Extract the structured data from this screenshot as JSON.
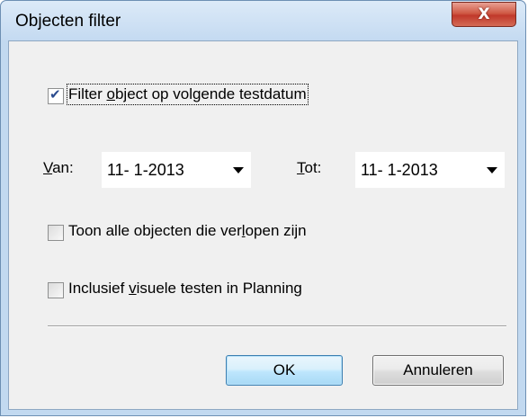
{
  "window": {
    "title": "Objecten filter",
    "close_glyph": "X"
  },
  "filter_checkbox": {
    "checked": true,
    "label_pre": "Filter ",
    "label_accel": "o",
    "label_post": "bject op volgende testdatum"
  },
  "van": {
    "label_accel": "V",
    "label_post": "an:",
    "value": "11- 1-2013"
  },
  "tot": {
    "label_accel": "T",
    "label_post": "ot:",
    "value": "11- 1-2013"
  },
  "expired_checkbox": {
    "checked": false,
    "label_pre": "Toon alle objecten die ver",
    "label_accel": "l",
    "label_post": "open zijn"
  },
  "visual_checkbox": {
    "checked": false,
    "label_pre": "Inclusief ",
    "label_accel": "v",
    "label_post": "isuele testen in Planning"
  },
  "buttons": {
    "ok_label": "OK",
    "cancel_label": "Annuleren"
  },
  "colors": {
    "title_bar": "#c4daf1",
    "close_button": "#c0392b",
    "dialog_background": "#f0f0f0",
    "default_button_border": "#3c7fb1"
  },
  "icons": {
    "close": "close-icon",
    "dropdown": "chevron-down-icon",
    "check": "checkmark-icon"
  }
}
